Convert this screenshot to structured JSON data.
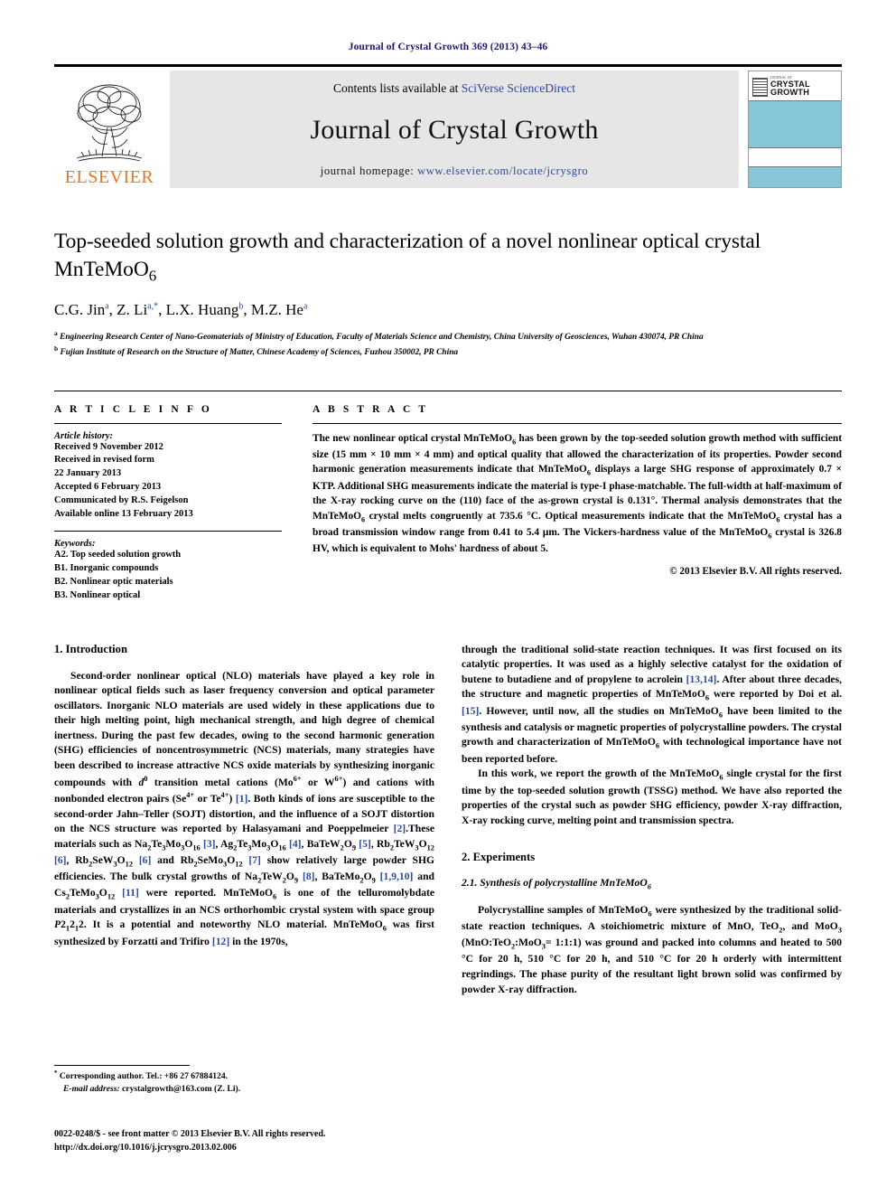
{
  "running_head": "Journal of Crystal Growth 369 (2013) 43–46",
  "masthead": {
    "publisher": "ELSEVIER",
    "contents_prefix": "Contents lists available at ",
    "contents_link": "SciVerse ScienceDirect",
    "journal_title": "Journal of Crystal Growth",
    "homepage_prefix": "journal homepage: ",
    "homepage_link": "www.elsevier.com/locate/jcrysgro",
    "cover": {
      "pre_title": "JOURNAL OF",
      "main_title_line1": "CRYSTAL",
      "main_title_line2": "GROWTH"
    }
  },
  "article": {
    "title": "Top-seeded solution growth and characterization of a novel nonlinear optical crystal MnTeMoO",
    "title_sub": "6",
    "authors_html": "C.G. Jin a, Z. Li a,*, L.X. Huang b, M.Z. He a",
    "affiliation_a": "Engineering Research Center of Nano-Geomaterials of Ministry of Education, Faculty of Materials Science and Chemistry, China University of Geosciences, Wuhan 430074, PR China",
    "affiliation_b": "Fujian Institute of Research on the Structure of Matter, Chinese Academy of Sciences, Fuzhou 350002, PR China"
  },
  "article_info": {
    "heading": "A R T I C L E   I N F O",
    "history_label": "Article history:",
    "history": [
      "Received 9 November 2012",
      "Received in revised form",
      "22 January 2013",
      "Accepted 6 February 2013",
      "Communicated by R.S. Feigelson",
      "Available online 13 February 2013"
    ],
    "keywords_label": "Keywords:",
    "keywords": [
      "A2. Top seeded solution growth",
      "B1. Inorganic compounds",
      "B2. Nonlinear optic materials",
      "B3. Nonlinear optical"
    ]
  },
  "abstract": {
    "heading": "A B S T R A C T",
    "text": "The new nonlinear optical crystal MnTeMoO6 has been grown by the top-seeded solution growth method with sufficient size (15 mm × 10 mm × 4 mm) and optical quality that allowed the characterization of its properties. Powder second harmonic generation measurements indicate that MnTeMoO6 displays a large SHG response of approximately 0.7 × KTP. Additional SHG measurements indicate the material is type-I phase-matchable. The full-width at half-maximum of the X-ray rocking curve on the (110) face of the as-grown crystal is 0.131°. Thermal analysis demonstrates that the MnTeMoO6 crystal melts congruently at 735.6 °C. Optical measurements indicate that the MnTeMoO6 crystal has a broad transmission window range from 0.41 to 5.4 μm. The Vickers-hardness value of the MnTeMoO6 crystal is 326.8 HV, which is equivalent to Mohs' hardness of about 5.",
    "copyright": "© 2013 Elsevier B.V. All rights reserved."
  },
  "sections": {
    "intro_heading": "1.  Introduction",
    "intro_p1": "Second-order nonlinear optical (NLO) materials have played a key role in nonlinear optical fields such as laser frequency conversion and optical parameter oscillators. Inorganic NLO materials are used widely in these applications due to their high melting point, high mechanical strength, and high degree of chemical inertness. During the past few decades, owing to the second harmonic generation (SHG) efficiencies of noncentrosymmetric (NCS) materials, many strategies have been described to increase attractive NCS oxide materials by synthesizing inorganic compounds with d0 transition metal cations (Mo6+ or W6+) and cations with nonbonded electron pairs (Se4+ or Te4+) [1]. Both kinds of ions are susceptible to the second-order Jahn–Teller (SOJT) distortion, and the influence of a SOJT distortion on the NCS structure was reported by Halasyamani and Poeppelmeier [2].These materials such as Na2Te3Mo3O16 [3], Ag2Te3Mo3O16 [4], BaTeW2O9 [5], Rb2TeW3O12 [6], Rb2SeW3O12 [6] and Rb2SeMo3O12 [7] show relatively large powder SHG efficiencies. The bulk crystal growths of Na2TeW2O9 [8], BaTeMo2O9 [1,9,10] and Cs2TeMo3O12 [11] were reported. MnTeMoO6 is one of the telluromolybdate materials and crystallizes in an NCS orthorhombic crystal system with space group P21212. It is a potential and noteworthy NLO material. MnTeMoO6 was first synthesized by Forzatti and Trifiro [12] in the 1970s,",
    "intro_p1_cont": "through the traditional solid-state reaction techniques. It was first focused on its catalytic properties. It was used as a highly selective catalyst for the oxidation of butene to butadiene and of propylene to acrolein [13,14]. After about three decades, the structure and magnetic properties of MnTeMoO6 were reported by Doi et al. [15]. However, until now, all the studies on MnTeMoO6 have been limited to the synthesis and catalysis or magnetic properties of polycrystalline powders. The crystal growth and characterization of MnTeMoO6 with technological importance have not been reported before.",
    "intro_p2": "In this work, we report the growth of the MnTeMoO6 single crystal for the first time by the top-seeded solution growth (TSSG) method. We have also reported the properties of the crystal such as powder SHG efficiency, powder X-ray diffraction, X-ray rocking curve, melting point and transmission spectra.",
    "exp_heading": "2.  Experiments",
    "exp_sub_heading": "2.1.  Synthesis of polycrystalline MnTeMoO6",
    "exp_p1": "Polycrystalline samples of MnTeMoO6 were synthesized by the traditional solid-state reaction techniques. A stoichiometric mixture of MnO, TeO2, and MoO3 (MnO:TeO2:MoO3= 1:1:1) was ground and packed into columns and heated to 500 °C for 20 h, 510 °C for 20 h, and 510 °C for 20 h orderly with intermittent regrindings. The phase purity of the resultant light brown solid was confirmed by powder X-ray diffraction."
  },
  "footnotes": {
    "corresponding": "Corresponding author. Tel.: +86 27 67884124.",
    "email_label": "E-mail address:",
    "email": "crystalgrowth@163.com (Z. Li)."
  },
  "footer": {
    "issn_line": "0022-0248/$ - see front matter © 2013 Elsevier B.V. All rights reserved.",
    "doi_line": "http://dx.doi.org/10.1016/j.jcrysgro.2013.02.006"
  },
  "colors": {
    "link": "#2b4a9b",
    "elsevier_orange": "#E87722",
    "cover_blue": "#87c5d8",
    "band_gray": "#e6e6e6"
  }
}
